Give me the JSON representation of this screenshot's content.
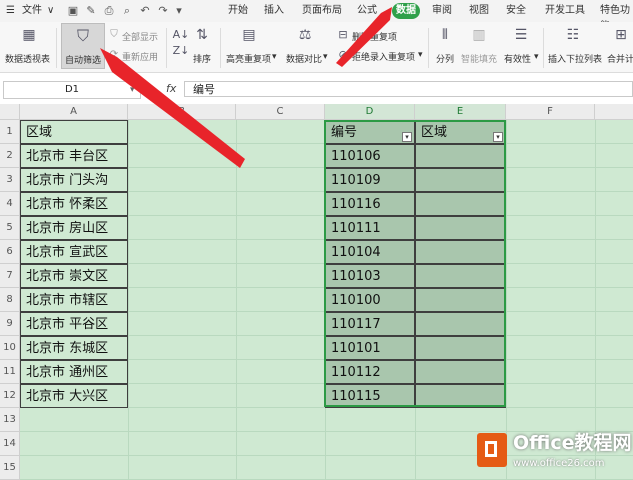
{
  "menu": {
    "file": "文件",
    "tabs": [
      {
        "label": "开始"
      },
      {
        "label": "插入"
      },
      {
        "label": "页面布局"
      },
      {
        "label": "公式"
      },
      {
        "label": "数据"
      },
      {
        "label": "审阅"
      },
      {
        "label": "视图"
      },
      {
        "label": "安全"
      },
      {
        "label": "开发工具"
      },
      {
        "label": "特色功能"
      }
    ],
    "active_tab_color": "#2fa04a"
  },
  "ribbon": {
    "pivot": "数据透视表",
    "autofilter": "自动筛选",
    "show_all": "全部显示",
    "reapply": "重新应用",
    "sort": "排序",
    "highlight_dup": "高亮重复项",
    "compare": "数据对比",
    "delete_dup": "删除重复项",
    "reject_dup": "拒绝录入重复项",
    "split": "分列",
    "smart_fill": "智能填充",
    "validity": "有效性",
    "dropdown_list": "插入下拉列表",
    "merge_calc": "合并计"
  },
  "formula": {
    "namebox": "D1",
    "fx": "fx",
    "content": "编号"
  },
  "columns": [
    "A",
    "B",
    "C",
    "D",
    "E",
    "F"
  ],
  "rows": [
    "1",
    "2",
    "3",
    "4",
    "5",
    "6",
    "7",
    "8",
    "9",
    "10",
    "11",
    "12",
    "13",
    "14",
    "15"
  ],
  "cells": {
    "A": [
      "区域",
      "北京市 丰台区",
      "北京市 门头沟",
      "北京市 怀柔区",
      "北京市 房山区",
      "北京市 宣武区",
      "北京市 崇文区",
      "北京市 市辖区",
      "北京市 平谷区",
      "北京市 东城区",
      "北京市 通州区",
      "北京市 大兴区"
    ],
    "D": [
      "编号",
      "110106",
      "110109",
      "110116",
      "110111",
      "110104",
      "110103",
      "110100",
      "110117",
      "110101",
      "110112",
      "110115"
    ],
    "E": [
      "区域"
    ]
  },
  "watermark": {
    "title": "Office教程网",
    "url": "www.office26.com"
  }
}
